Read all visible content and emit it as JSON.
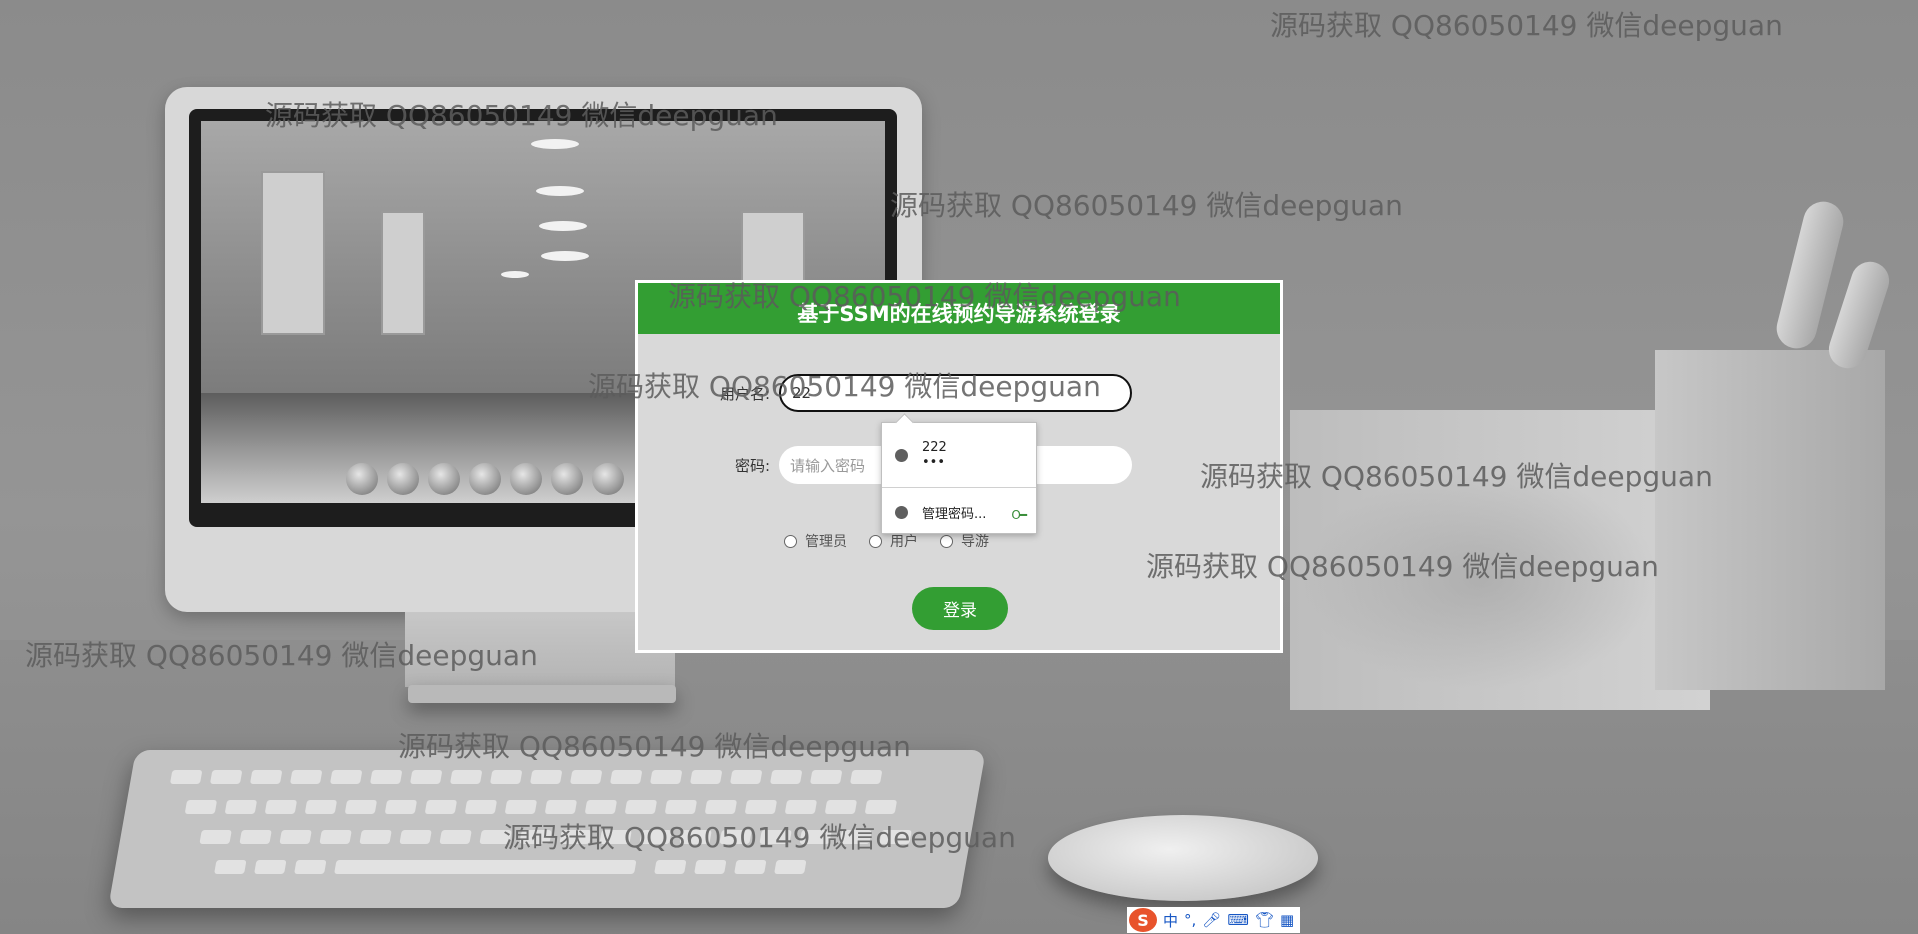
{
  "watermark_text": "源码获取 QQ86050149 微信deepguan",
  "login": {
    "title": "基于SSM的在线预约导游系统登录",
    "username_label": "用户名:",
    "username_value": "22",
    "password_label": "密码:",
    "password_placeholder": "请输入密码",
    "roles": [
      "管理员",
      "用户",
      "导游"
    ],
    "submit_label": "登录"
  },
  "autofill": {
    "username": "222",
    "password_mask": "•••",
    "manage_label": "管理密码..."
  },
  "ime": {
    "logo": "S",
    "mode": "中",
    "punct": "°,",
    "icons": [
      "microphone-icon",
      "keyboard-icon",
      "shirt-icon",
      "grid-icon"
    ]
  },
  "colors": {
    "accent": "#339e33",
    "panel": "#d9d9d9"
  }
}
